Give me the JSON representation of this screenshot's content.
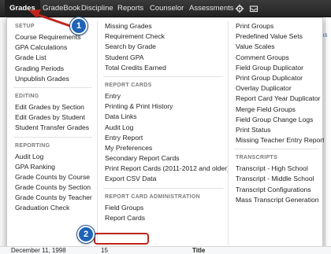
{
  "navbar": {
    "items": [
      {
        "label": "Grades",
        "active": true
      },
      {
        "label": "GradeBook"
      },
      {
        "label": "Discipline"
      },
      {
        "label": "Reports"
      },
      {
        "label": "Counselor"
      },
      {
        "label": "Assessments"
      }
    ],
    "icons": [
      "gear-icon",
      "inbox-icon"
    ]
  },
  "right_link": "ns",
  "menu": {
    "col1": {
      "sections": [
        {
          "title": "SETUP",
          "items": [
            "Course Requirements",
            "GPA Calculations",
            "Grade List",
            "Grading Periods",
            "Unpublish Grades"
          ]
        },
        {
          "title": "EDITING",
          "items": [
            "Edit Grades by Section",
            "Edit Grades by Student",
            "Student Transfer Grades"
          ]
        },
        {
          "title": "REPORTING",
          "items": [
            "Audit Log",
            "GPA Ranking",
            "Grade Counts by Course",
            "Grade Counts by Section",
            "Grade Counts by Teacher",
            "Graduation Check"
          ]
        }
      ]
    },
    "col2": {
      "sections": [
        {
          "title": "",
          "items": [
            "Missing Grades",
            "Requirement Check",
            "Search by Grade",
            "Student GPA",
            "Total Credits Earned"
          ]
        },
        {
          "title": "REPORT CARDS",
          "items": [
            "Entry",
            "Printing & Print History",
            "Data Links",
            "Audit Log",
            "Entry Report",
            "My Preferences",
            "Secondary Report Cards",
            "Print Report Cards (2011-2012 and older)",
            "Export CSV Data"
          ]
        },
        {
          "title": "REPORT CARD ADMINISTRATION",
          "items": [
            "Field Groups",
            "Report Cards"
          ]
        }
      ]
    },
    "col3": {
      "sections": [
        {
          "title": "",
          "items": [
            "Print Groups",
            "Predefined Value Sets",
            "Value Scales",
            "Comment Groups",
            "Field Group Duplicator",
            "Print Group Duplicator",
            "Overlay Duplicator",
            "Report Card Year Duplicator",
            "Merge Field Groups",
            "Field Group Change Logs",
            "Print Status",
            "Missing Teacher Entry Report"
          ]
        },
        {
          "title": "TRANSCRIPTS",
          "items": [
            "Transcript - High School",
            "Transcript - Middle School",
            "Transcript Configurations",
            "Mass Transcript Generation"
          ]
        }
      ]
    }
  },
  "callouts": [
    "1",
    "2"
  ],
  "bottom_row": {
    "date": "December 11, 1998",
    "count": "15",
    "title": "Title"
  },
  "colors": {
    "highlight": "#c0251b",
    "callout": "#1f63b5",
    "navbar": "#2c2c2c"
  }
}
